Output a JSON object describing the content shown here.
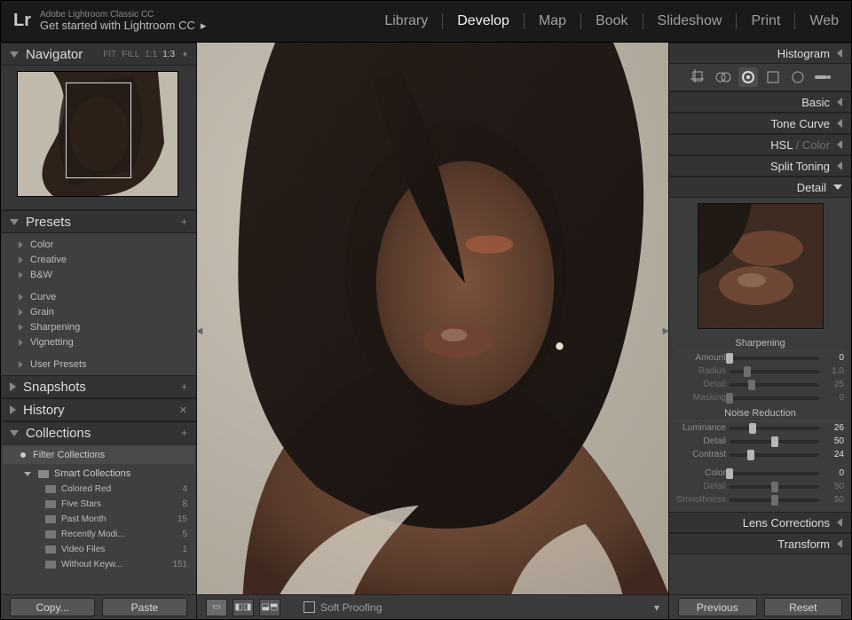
{
  "app": {
    "title_small": "Adobe Lightroom Classic CC",
    "title_big": "Get started with Lightroom CC"
  },
  "modules": [
    "Library",
    "Develop",
    "Map",
    "Book",
    "Slideshow",
    "Print",
    "Web"
  ],
  "active_module": "Develop",
  "navigator": {
    "title": "Navigator",
    "modes": [
      "FIT",
      "FILL",
      "1:1",
      "1:3"
    ],
    "selected": "1:3"
  },
  "presets": {
    "title": "Presets",
    "groups1": [
      "Color",
      "Creative",
      "B&W"
    ],
    "groups2": [
      "Curve",
      "Grain",
      "Sharpening",
      "Vignetting"
    ],
    "groups3": [
      "User Presets"
    ]
  },
  "snapshots": {
    "title": "Snapshots"
  },
  "history": {
    "title": "History"
  },
  "collections": {
    "title": "Collections",
    "filter": "Filter Collections",
    "group": "Smart Collections",
    "items": [
      {
        "name": "Colored Red",
        "count": 4
      },
      {
        "name": "Five Stars",
        "count": 8
      },
      {
        "name": "Past Month",
        "count": 15
      },
      {
        "name": "Recently Modi...",
        "count": 5
      },
      {
        "name": "Video Files",
        "count": 1
      },
      {
        "name": "Without Keyw...",
        "count": 151
      }
    ]
  },
  "buttons": {
    "copy": "Copy...",
    "paste": "Paste",
    "previous": "Previous",
    "reset": "Reset",
    "soft_proof": "Soft Proofing"
  },
  "right_panels": {
    "histogram": "Histogram",
    "basic": "Basic",
    "tone_curve": "Tone Curve",
    "hsl": "HSL",
    "color_suffix": " / Color",
    "split_toning": "Split Toning",
    "detail": "Detail",
    "lens_corr": "Lens Corrections",
    "transform": "Transform"
  },
  "tools": [
    "crop-icon",
    "spot-removal-icon",
    "redeye-icon",
    "graduated-filter-icon",
    "radial-filter-icon",
    "adjustment-brush-icon"
  ],
  "detail": {
    "sharpening": {
      "title": "Sharpening",
      "rows": [
        {
          "label": "Amount",
          "value": 0,
          "pos": 0,
          "active": true
        },
        {
          "label": "Radius",
          "value": "1.0",
          "pos": 20,
          "active": false
        },
        {
          "label": "Detail",
          "value": 25,
          "pos": 25,
          "active": false
        },
        {
          "label": "Masking",
          "value": 0,
          "pos": 0,
          "active": false
        }
      ]
    },
    "noise": {
      "title": "Noise Reduction",
      "rows": [
        {
          "label": "Luminance",
          "value": 26,
          "pos": 26,
          "active": true
        },
        {
          "label": "Detail",
          "value": 50,
          "pos": 50,
          "active": true
        },
        {
          "label": "Contrast",
          "value": 24,
          "pos": 24,
          "active": true
        }
      ],
      "rows2": [
        {
          "label": "Color",
          "value": 0,
          "pos": 0,
          "active": true
        },
        {
          "label": "Detail",
          "value": 50,
          "pos": 50,
          "active": false
        },
        {
          "label": "Smoothness",
          "value": 50,
          "pos": 50,
          "active": false
        }
      ]
    }
  }
}
